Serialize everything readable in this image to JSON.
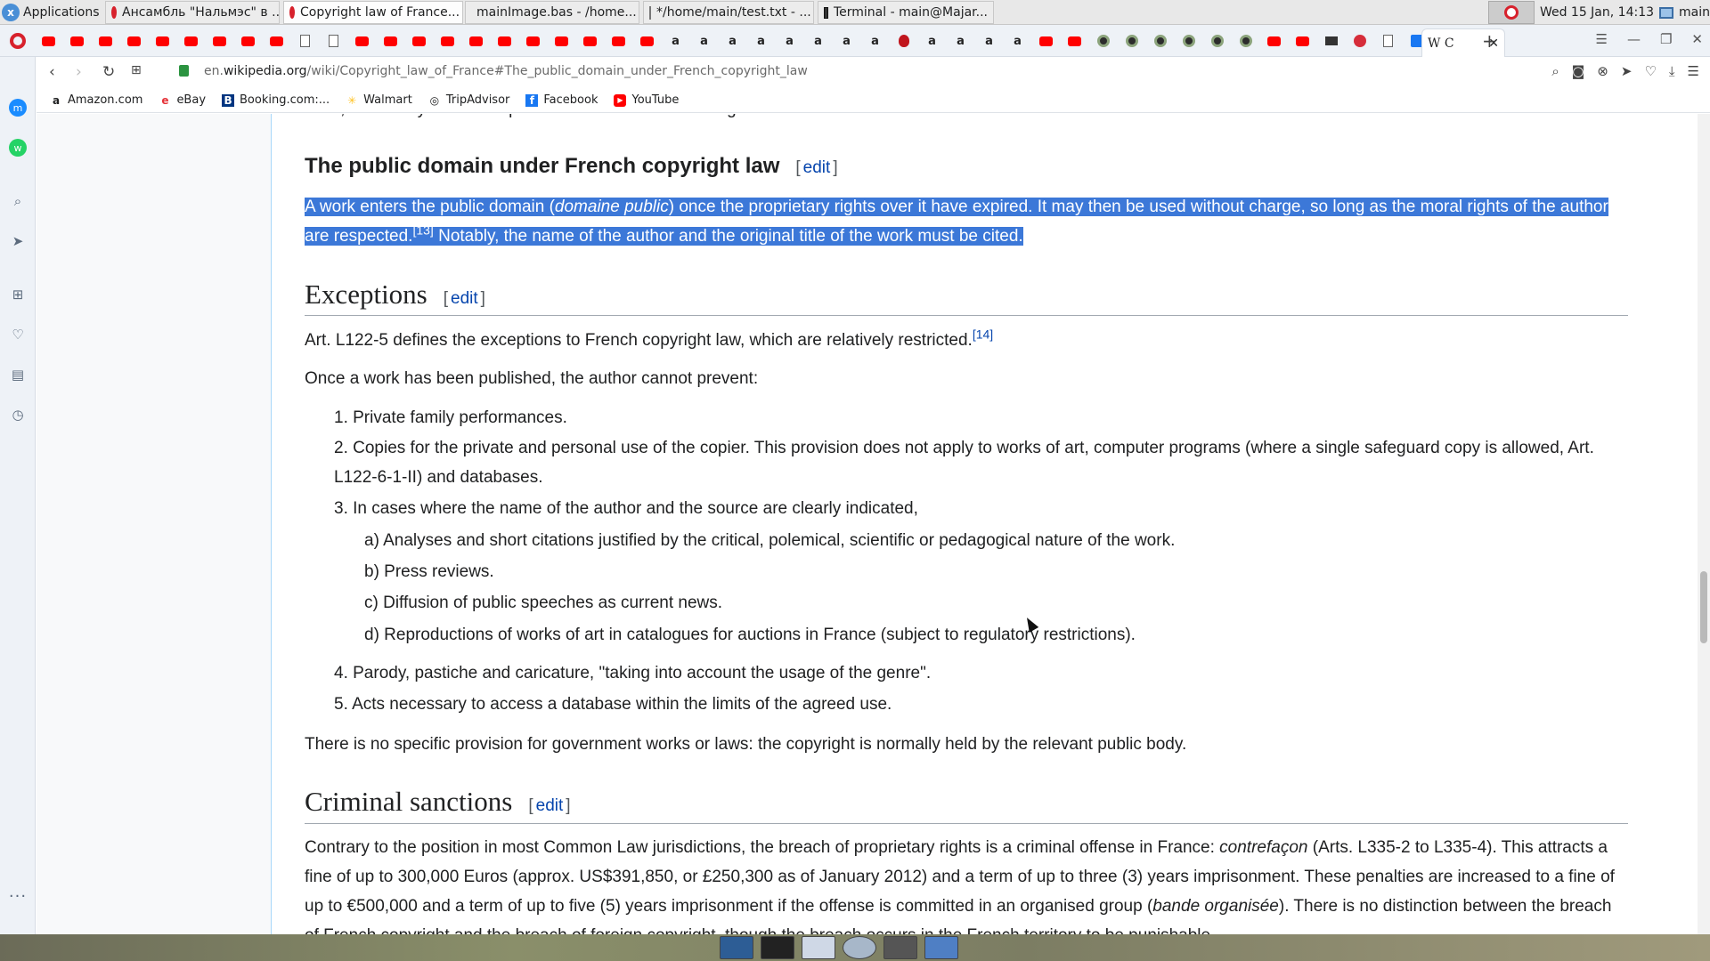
{
  "os_panel": {
    "applications_label": "Applications",
    "tasks": [
      {
        "label": "Ансамбль \"Нальмэс\" в ...",
        "icon": "opera-icon"
      },
      {
        "label": "Copyright law of France...",
        "icon": "opera-icon"
      },
      {
        "label": "mainImage.bas - /home...",
        "icon": "mousepad-icon"
      },
      {
        "label": "*/home/main/test.txt - ...",
        "icon": "text-editor-icon"
      },
      {
        "label": "Terminal - main@Majar...",
        "icon": "terminal-icon"
      }
    ],
    "clock": "Wed 15 Jan, 14:13",
    "user": "main"
  },
  "browser": {
    "active_tab": {
      "label": "W C",
      "icon": "wikipedia-icon"
    },
    "url_prefix": "en.",
    "url_domain": "wikipedia.org",
    "url_path": "/wiki/Copyright_law_of_France#The_public_domain_under_French_copyright_law",
    "bookmarks": [
      {
        "label": "Amazon.com",
        "icon": "amazon-icon"
      },
      {
        "label": "eBay",
        "icon": "ebay-icon"
      },
      {
        "label": "Booking.com:...",
        "icon": "booking-icon"
      },
      {
        "label": "Walmart",
        "icon": "walmart-icon"
      },
      {
        "label": "TripAdvisor",
        "icon": "tripadvisor-icon"
      },
      {
        "label": "Facebook",
        "icon": "facebook-icon"
      },
      {
        "label": "YouTube",
        "icon": "youtube-icon"
      }
    ]
  },
  "article": {
    "clipped_line": "work, and always has the option to refrain from exercising them.",
    "edit_label": "edit",
    "section1": {
      "title": "The public domain under French copyright law",
      "para_a": "A work enters the public domain (",
      "para_term": "domaine public",
      "para_b": ") once the proprietary rights over it have expired. It may then be used without charge, so long as the moral rights of the author are respected.",
      "ref": "[13]",
      "para_c": " Notably, the name of the author and the original title of the work must be cited."
    },
    "section2": {
      "title": "Exceptions",
      "intro": "Art. L122-5 defines the exceptions to French copyright law, which are relatively restricted.",
      "intro_ref": "[14]",
      "lead": "Once a work has been published, the author cannot prevent:",
      "items": [
        "1. Private family performances.",
        "2. Copies for the private and personal use of the copier. This provision does not apply to works of art, computer programs (where a single safeguard copy is allowed, Art. L122-6-1-II) and databases.",
        "3. In cases where the name of the author and the source are clearly indicated,"
      ],
      "subitems": [
        "a) Analyses and short citations justified by the critical, polemical, scientific or pedagogical nature of the work.",
        "b) Press reviews.",
        "c) Diffusion of public speeches as current news.",
        "d) Reproductions of works of art in catalogues for auctions in France (subject to regulatory restrictions)."
      ],
      "items_after": [
        "4. Parody, pastiche and caricature, \"taking into account the usage of the genre\".",
        "5. Acts necessary to access a database within the limits of the agreed use."
      ],
      "closing": "There is no specific provision for government works or laws: the copyright is normally held by the relevant public body."
    },
    "section3": {
      "title": "Criminal sanctions",
      "para_a": "Contrary to the position in most Common Law jurisdictions, the breach of proprietary rights is a criminal offense in France: ",
      "term1": "contrefaçon",
      "para_b": " (Arts. L335-2 to L335-4). This attracts a fine of up to 300,000 Euros (approx. US$391,850, or £250,300 as of January 2012) and a term of up to three (3) years imprisonment. These penalties are increased to a fine of up to €500,000 and a term of up to five (5) years imprisonment if the offense is committed in an organised group (",
      "term2": "bande organisée",
      "para_c": "). There is no distinction between the breach of French copyright and the breach of foreign copyright, though the breach occurs in the French territory to be punishable."
    }
  }
}
